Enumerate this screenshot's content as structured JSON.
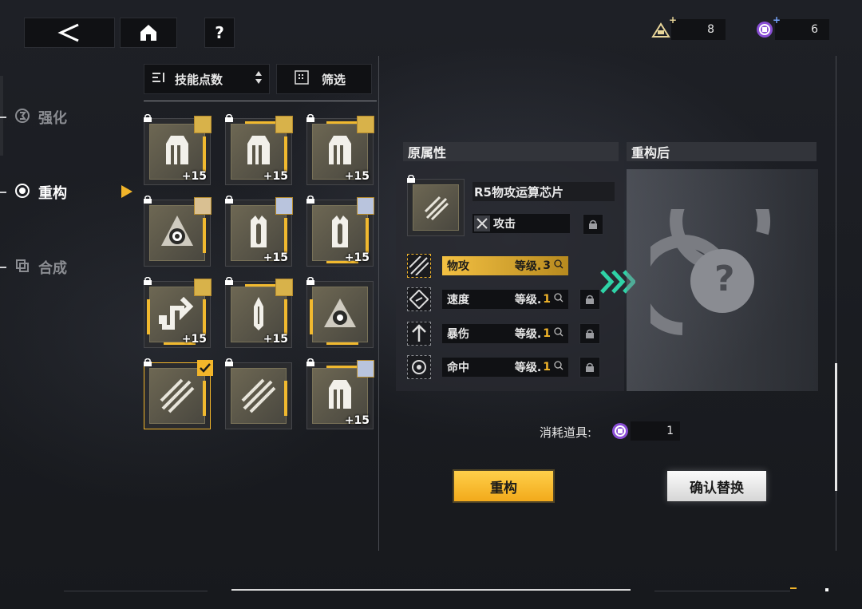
{
  "currencies": [
    {
      "icon": "chip-stack-icon",
      "value": "8"
    },
    {
      "icon": "rebuild-token-icon",
      "value": "6"
    }
  ],
  "nav": {
    "items": [
      {
        "label": "强化",
        "active": false
      },
      {
        "label": "重构",
        "active": true
      },
      {
        "label": "合成",
        "active": false
      }
    ]
  },
  "sort": {
    "label": "技能点数"
  },
  "filter": {
    "label": "筛选"
  },
  "grid": {
    "items": [
      {
        "glyph": "pillar",
        "level": "+15",
        "avatar": "gold"
      },
      {
        "glyph": "pillar",
        "level": "+15",
        "avatar": "gold"
      },
      {
        "glyph": "pillar",
        "level": "+15",
        "avatar": "gold"
      },
      {
        "glyph": "target",
        "level": "",
        "avatar": "blond"
      },
      {
        "glyph": "spiked",
        "level": "+15",
        "avatar": "silver"
      },
      {
        "glyph": "spiked",
        "level": "+15",
        "avatar": "silver"
      },
      {
        "glyph": "bend",
        "level": "+15",
        "avatar": "gold"
      },
      {
        "glyph": "blade",
        "level": "+15",
        "avatar": "gold"
      },
      {
        "glyph": "eye",
        "level": "",
        "avatar": ""
      },
      {
        "glyph": "slash",
        "level": "",
        "avatar": "",
        "selected": true
      },
      {
        "glyph": "slash",
        "level": "",
        "avatar": ""
      },
      {
        "glyph": "pillar",
        "level": "+15",
        "avatar": "silver"
      }
    ]
  },
  "original": {
    "title": "原属性",
    "chip_name": "R5物攻运算芯片",
    "main_stat": "攻击",
    "attrs": [
      {
        "name": "物攻",
        "level_label": "等级.",
        "level": "3",
        "highlight": true
      },
      {
        "name": "速度",
        "level_label": "等级.",
        "level": "1",
        "highlight": false
      },
      {
        "name": "暴伤",
        "level_label": "等级.",
        "level": "1",
        "highlight": false
      },
      {
        "name": "命中",
        "level_label": "等级.",
        "level": "1",
        "highlight": false
      }
    ]
  },
  "result": {
    "title": "重构后",
    "placeholder": "?"
  },
  "cost": {
    "label": "消耗道具:",
    "value": "1"
  },
  "buttons": {
    "rebuild": "重构",
    "confirm": "确认替换"
  },
  "colors": {
    "accent": "#f2b52a",
    "panel": "#101114",
    "highlight_start": "#f3c042",
    "highlight_end": "#b78a1f",
    "arrow": "#2fd3a7"
  }
}
